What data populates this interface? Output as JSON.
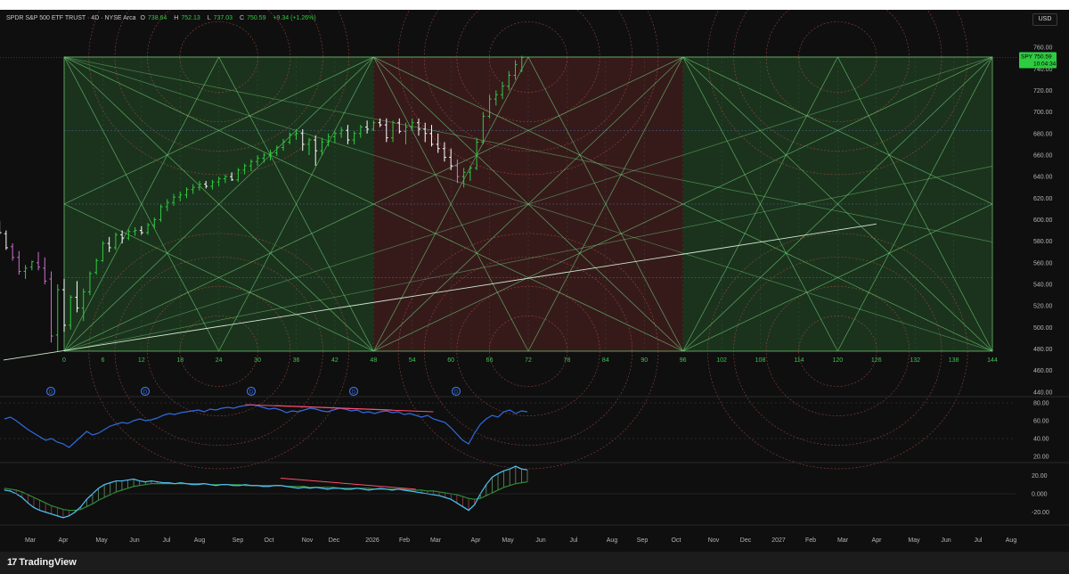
{
  "header": {
    "symbol": "SPDR S&P 500 ETF TRUST · 4D · NYSE Arca",
    "open_label": "O",
    "open": "738.64",
    "high_label": "H",
    "high": "752.13",
    "low_label": "L",
    "low": "737.03",
    "close_label": "C",
    "close": "750.59",
    "change": "+9.34 (+1.26%)"
  },
  "currency_button": "USD",
  "price_tag": {
    "ticker": "SPY",
    "price": "750.59",
    "countdown": "10:04:34"
  },
  "footer": {
    "brand_mark": "17",
    "brand": "TradingView"
  },
  "colors": {
    "background": "#0f0f0f",
    "green_zone": "#1d3a1f",
    "red_zone": "#3d1c1c",
    "up_bar": "#2ecc40",
    "down_bar": "#ffffff",
    "pink_bar": "#d070d0",
    "rsi": "#2f6be0",
    "divergence": "#ff4d6d",
    "macd": "#4fc3f7",
    "signal": "#2e8b3a",
    "price_tag": "#2ecc40"
  },
  "chart_data": [
    {
      "type": "candlestick",
      "name": "price",
      "y_axis_ticks": [
        760,
        740,
        720,
        700,
        680,
        660,
        640,
        620,
        600,
        580,
        560,
        540,
        520,
        500,
        480,
        460,
        440
      ],
      "ylim": [
        430,
        770
      ],
      "gann_box": {
        "x_ticks": [
          "0",
          "6",
          "12",
          "18",
          "24",
          "30",
          "36",
          "42",
          "48",
          "54",
          "60",
          "66",
          "72",
          "78",
          "84",
          "90",
          "96",
          "102",
          "108",
          "114",
          "120",
          "126",
          "132",
          "138",
          "144"
        ],
        "price_range": [
          478,
          751
        ],
        "zones": [
          "green",
          "red",
          "green"
        ]
      },
      "bars": [
        [
          -12,
          596,
          604,
          593,
          603
        ],
        [
          -11,
          600,
          606,
          593,
          597
        ],
        [
          -10,
          596,
          599,
          586,
          588
        ],
        [
          -9,
          587,
          590,
          572,
          574
        ],
        [
          -8,
          575,
          578,
          562,
          565
        ],
        [
          -7,
          565,
          571,
          549,
          552
        ],
        [
          -6,
          552,
          558,
          545,
          555
        ],
        [
          -5,
          556,
          562,
          553,
          561
        ],
        [
          -4,
          560,
          570,
          553,
          556
        ],
        [
          -3,
          555,
          565,
          540,
          543
        ],
        [
          -2,
          545,
          552,
          486,
          492
        ],
        [
          -1,
          493,
          540,
          478,
          535
        ],
        [
          0,
          535,
          545,
          496,
          502
        ],
        [
          1,
          502,
          530,
          498,
          528
        ],
        [
          2,
          528,
          543,
          514,
          518
        ],
        [
          3,
          518,
          536,
          506,
          533
        ],
        [
          4,
          533,
          552,
          530,
          550
        ],
        [
          5,
          551,
          564,
          549,
          562
        ],
        [
          6,
          562,
          580,
          561,
          578
        ],
        [
          7,
          578,
          584,
          570,
          574
        ],
        [
          8,
          574,
          588,
          572,
          586
        ],
        [
          9,
          586,
          590,
          578,
          583
        ],
        [
          10,
          583,
          591,
          581,
          589
        ],
        [
          11,
          589,
          593,
          585,
          590
        ],
        [
          12,
          590,
          594,
          586,
          588
        ],
        [
          13,
          588,
          597,
          586,
          595
        ],
        [
          14,
          595,
          602,
          592,
          600
        ],
        [
          15,
          600,
          614,
          598,
          612
        ],
        [
          16,
          612,
          619,
          608,
          616
        ],
        [
          17,
          616,
          624,
          613,
          621
        ],
        [
          18,
          621,
          626,
          617,
          623
        ],
        [
          19,
          623,
          630,
          620,
          628
        ],
        [
          20,
          628,
          633,
          624,
          630
        ],
        [
          21,
          630,
          636,
          627,
          633
        ],
        [
          22,
          633,
          636,
          629,
          631
        ],
        [
          23,
          631,
          637,
          628,
          635
        ],
        [
          24,
          635,
          640,
          631,
          638
        ],
        [
          25,
          638,
          642,
          634,
          640
        ],
        [
          26,
          640,
          644,
          636,
          637
        ],
        [
          27,
          637,
          648,
          635,
          646
        ],
        [
          28,
          646,
          652,
          642,
          650
        ],
        [
          29,
          650,
          656,
          645,
          654
        ],
        [
          30,
          654,
          660,
          650,
          657
        ],
        [
          31,
          657,
          662,
          653,
          660
        ],
        [
          32,
          660,
          665,
          655,
          662
        ],
        [
          33,
          662,
          669,
          659,
          667
        ],
        [
          34,
          667,
          675,
          664,
          672
        ],
        [
          35,
          672,
          681,
          670,
          679
        ],
        [
          36,
          679,
          684,
          674,
          680
        ],
        [
          37,
          680,
          684,
          664,
          670
        ],
        [
          38,
          670,
          676,
          660,
          674
        ],
        [
          39,
          674,
          678,
          650,
          664
        ],
        [
          40,
          664,
          676,
          660,
          672
        ],
        [
          41,
          672,
          680,
          668,
          677
        ],
        [
          42,
          677,
          682,
          671,
          680
        ],
        [
          43,
          680,
          686,
          676,
          683
        ],
        [
          44,
          683,
          688,
          670,
          674
        ],
        [
          45,
          674,
          682,
          670,
          680
        ],
        [
          46,
          680,
          688,
          676,
          686
        ],
        [
          47,
          686,
          692,
          680,
          684
        ],
        [
          48,
          684,
          692,
          682,
          690
        ],
        [
          49,
          690,
          694,
          686,
          688
        ],
        [
          50,
          688,
          694,
          672,
          676
        ],
        [
          51,
          676,
          692,
          672,
          690
        ],
        [
          52,
          690,
          694,
          680,
          682
        ],
        [
          53,
          682,
          690,
          670,
          686
        ],
        [
          54,
          686,
          694,
          682,
          690
        ],
        [
          55,
          690,
          694,
          678,
          684
        ],
        [
          56,
          684,
          690,
          672,
          680
        ],
        [
          57,
          680,
          688,
          668,
          670
        ],
        [
          58,
          670,
          680,
          662,
          666
        ],
        [
          59,
          666,
          672,
          654,
          658
        ],
        [
          60,
          658,
          666,
          646,
          650
        ],
        [
          61,
          650,
          656,
          634,
          640
        ],
        [
          62,
          640,
          648,
          630,
          644
        ],
        [
          63,
          644,
          650,
          636,
          648
        ],
        [
          64,
          648,
          676,
          646,
          672
        ],
        [
          65,
          672,
          700,
          670,
          696
        ],
        [
          66,
          696,
          716,
          694,
          712
        ],
        [
          67,
          712,
          720,
          706,
          716
        ],
        [
          68,
          716,
          728,
          712,
          724
        ],
        [
          69,
          724,
          738,
          720,
          734
        ],
        [
          70,
          734,
          748,
          730,
          744
        ],
        [
          71,
          738.64,
          752.13,
          737.03,
          750.59
        ]
      ]
    },
    {
      "type": "line",
      "name": "RSI",
      "y_axis_ticks": [
        80,
        60,
        40,
        20
      ],
      "ylim": [
        15,
        85
      ],
      "values": [
        62,
        64,
        60,
        55,
        50,
        46,
        42,
        38,
        40,
        36,
        34,
        30,
        36,
        42,
        48,
        44,
        46,
        50,
        54,
        56,
        58,
        57,
        60,
        62,
        60,
        61,
        63,
        66,
        68,
        67,
        69,
        70,
        71,
        72,
        70,
        73,
        72,
        74,
        75,
        74,
        76,
        77,
        78,
        77,
        75,
        73,
        74,
        72,
        69,
        71,
        70,
        72,
        74,
        73,
        71,
        70,
        72,
        74,
        73,
        71,
        72,
        69,
        70,
        68,
        70,
        71,
        69,
        70,
        67,
        68,
        66,
        64,
        66,
        62,
        60,
        58,
        52,
        45,
        38,
        34,
        46,
        56,
        62,
        66,
        64,
        70,
        72,
        68,
        71,
        70
      ],
      "divergence_lines": [
        [
          41,
          78,
          73,
          70
        ],
        [
          46,
          77,
          66,
          72
        ]
      ]
    },
    {
      "type": "histogram",
      "name": "MACD",
      "y_axis_ticks": [
        "20.00",
        "0.000",
        "-20.00"
      ],
      "ylim": [
        -32,
        32
      ],
      "macd": [
        4,
        3,
        0,
        -4,
        -10,
        -15,
        -18,
        -20,
        -22,
        -24,
        -26,
        -24,
        -20,
        -14,
        -6,
        0,
        6,
        10,
        12,
        14,
        14,
        15,
        16,
        14,
        13,
        14,
        13,
        12,
        12,
        11,
        12,
        11,
        10,
        10,
        11,
        10,
        9,
        10,
        10,
        9,
        9,
        10,
        9,
        9,
        8,
        8,
        9,
        9,
        8,
        7,
        6,
        7,
        6,
        7,
        6,
        5,
        6,
        6,
        5,
        5,
        6,
        5,
        4,
        5,
        6,
        5,
        4,
        5,
        4,
        3,
        2,
        1,
        0,
        -1,
        -2,
        -4,
        -6,
        -10,
        -14,
        -18,
        -12,
        0,
        10,
        18,
        22,
        25,
        27,
        30,
        27,
        26
      ],
      "signal": [
        6,
        5,
        4,
        2,
        -1,
        -4,
        -7,
        -10,
        -13,
        -15,
        -17,
        -18,
        -18,
        -17,
        -14,
        -11,
        -7,
        -4,
        -1,
        2,
        4,
        6,
        8,
        9,
        10,
        11,
        11,
        11,
        11,
        11,
        11,
        11,
        11,
        11,
        11,
        10,
        10,
        10,
        10,
        10,
        10,
        9,
        9,
        9,
        9,
        9,
        9,
        9,
        8,
        8,
        8,
        8,
        7,
        7,
        7,
        7,
        7,
        6,
        6,
        6,
        6,
        6,
        6,
        5,
        5,
        5,
        5,
        5,
        5,
        4,
        4,
        4,
        3,
        3,
        2,
        1,
        0,
        -1,
        -3,
        -5,
        -6,
        -5,
        -2,
        1,
        4,
        7,
        9,
        11,
        12,
        13
      ],
      "divergence_lines": [
        [
          47,
          17,
          70,
          5
        ]
      ]
    }
  ],
  "time_axis": [
    "Mar",
    "Apr",
    "May",
    "Jun",
    "Jul",
    "Aug",
    "Sep",
    "Oct",
    "Nov",
    "Dec",
    "2026",
    "Feb",
    "Mar",
    "Apr",
    "May",
    "Jun",
    "Jul",
    "Aug",
    "Sep",
    "Oct",
    "Nov",
    "Dec",
    "2027",
    "Feb",
    "Mar",
    "Apr",
    "May",
    "Jun",
    "Jul",
    "Aug"
  ],
  "event_markers": [
    "D",
    "D",
    "D",
    "D",
    "D"
  ]
}
